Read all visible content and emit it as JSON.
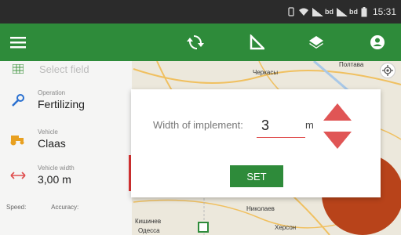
{
  "status_bar": {
    "time": "15:31",
    "signal_label": "bd"
  },
  "toolbar": {
    "menu_icon": "menu-icon",
    "sync_icon": "sync-icon",
    "measure_icon": "ruler-triangle-icon",
    "layers_icon": "layers-icon",
    "account_icon": "account-icon",
    "accent": "#2e8b3a"
  },
  "side_panel": {
    "select_field": "Select field",
    "operation": {
      "label": "Operation",
      "value": "Fertilizing"
    },
    "vehicle": {
      "label": "Vehicle",
      "value": "Claas"
    },
    "width": {
      "label": "Vehicle width",
      "value": "3,00 m"
    },
    "speed_label": "Speed:",
    "accuracy_label": "Accuracy:"
  },
  "dialog": {
    "label": "Width of implement:",
    "value": "3",
    "unit": "m",
    "set_label": "SET"
  },
  "map": {
    "labels": {
      "poltava": "Полтава",
      "cherkasy": "Черкасы",
      "mykolaiv": "Николаев",
      "kishinev": "Кишинев",
      "kherson": "Херсон",
      "odessa": "Одесса"
    }
  }
}
